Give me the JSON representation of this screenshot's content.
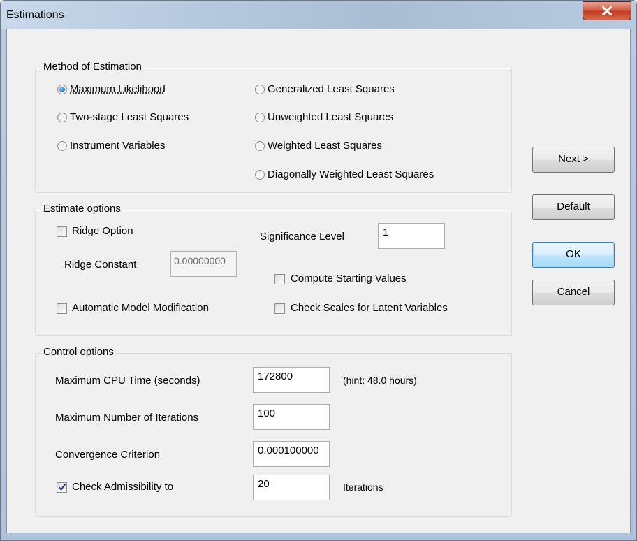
{
  "window": {
    "title": "Estimations"
  },
  "method_group": {
    "title": "Method of Estimation",
    "options": [
      {
        "label": "Maximum Likelihood",
        "selected": true
      },
      {
        "label": "Two-stage Least Squares",
        "selected": false
      },
      {
        "label": "Instrument Variables",
        "selected": false
      },
      {
        "label": "Generalized Least Squares",
        "selected": false
      },
      {
        "label": "Unweighted Least Squares",
        "selected": false
      },
      {
        "label": "Weighted Least Squares",
        "selected": false
      },
      {
        "label": "Diagonally Weighted Least Squares",
        "selected": false
      }
    ]
  },
  "estimate_group": {
    "title": "Estimate options",
    "ridge_option": {
      "label": "Ridge Option",
      "checked": false
    },
    "ridge_constant": {
      "label": "Ridge Constant",
      "value": "0.00000000"
    },
    "significance": {
      "label": "Significance Level",
      "value": "1"
    },
    "compute_starting": {
      "label": "Compute Starting Values",
      "checked": false
    },
    "auto_modification": {
      "label": "Automatic Model Modification",
      "checked": false
    },
    "check_scales": {
      "label": "Check Scales for Latent Variables",
      "checked": false
    }
  },
  "control_group": {
    "title": "Control options",
    "cpu_time": {
      "label": "Maximum CPU Time (seconds)",
      "value": "172800",
      "hint": "(hint: 48.0 hours)"
    },
    "iterations": {
      "label": "Maximum Number of Iterations",
      "value": "100"
    },
    "convergence": {
      "label": "Convergence Criterion",
      "value": "0.000100000"
    },
    "admissibility": {
      "label": "Check Admissibility to",
      "value": "20",
      "suffix": "Iterations",
      "checked": true
    }
  },
  "buttons": {
    "next": "Next >",
    "default": "Default",
    "ok": "OK",
    "cancel": "Cancel"
  },
  "colors": {
    "accent": "#3c7fb1",
    "close": "#c13c20",
    "check": "#1a3f8f"
  }
}
